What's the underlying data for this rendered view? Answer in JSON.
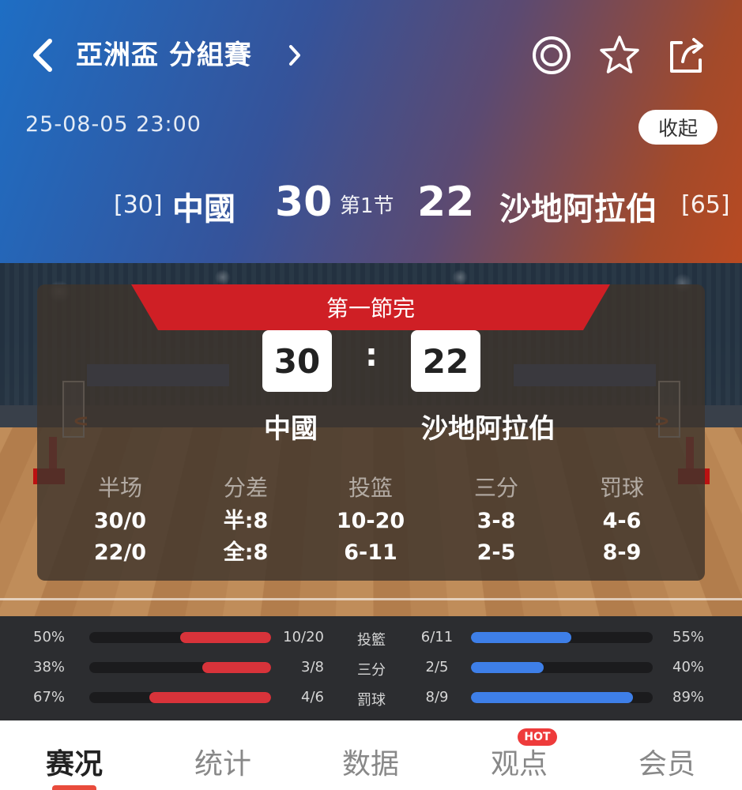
{
  "header": {
    "title": "亞洲盃 分組賽",
    "datetime": "25-08-05 23:00",
    "collapse_label": "收起",
    "home": {
      "rank": "[30]",
      "name": "中國",
      "score": "30"
    },
    "away": {
      "rank": "[65]",
      "name": "沙地阿拉伯",
      "score": "22"
    },
    "period": "第1节",
    "icons": [
      "back-icon",
      "chevron-right-icon",
      "target-icon",
      "star-icon",
      "share-icon"
    ]
  },
  "card": {
    "status": "第一節完",
    "home_score": "30",
    "away_score": "22",
    "colon": ":",
    "home_name": "中國",
    "away_name": "沙地阿拉伯",
    "stats": [
      {
        "label": "半场",
        "v1": "30/0",
        "v2": "22/0"
      },
      {
        "label": "分差",
        "v1": "半:8",
        "v2": "全:8"
      },
      {
        "label": "投篮",
        "v1": "10-20",
        "v2": "6-11"
      },
      {
        "label": "三分",
        "v1": "3-8",
        "v2": "2-5"
      },
      {
        "label": "罚球",
        "v1": "4-6",
        "v2": "8-9"
      }
    ]
  },
  "compare": [
    {
      "pct_l": "50%",
      "val_l": "10/20",
      "label": "投籃",
      "val_r": "6/11",
      "pct_r": "55%",
      "fill_l": 0.5,
      "fill_r": 0.55
    },
    {
      "pct_l": "38%",
      "val_l": "3/8",
      "label": "三分",
      "val_r": "2/5",
      "pct_r": "40%",
      "fill_l": 0.38,
      "fill_r": 0.4
    },
    {
      "pct_l": "67%",
      "val_l": "4/6",
      "label": "罰球",
      "val_r": "8/9",
      "pct_r": "89%",
      "fill_l": 0.67,
      "fill_r": 0.89
    }
  ],
  "colors": {
    "home_bar": "#d8333a",
    "away_bar": "#3e7fe8",
    "accent": "#e94b3c"
  },
  "tabs": [
    {
      "label": "赛况",
      "active": true
    },
    {
      "label": "统计",
      "active": false
    },
    {
      "label": "数据",
      "active": false
    },
    {
      "label": "观点",
      "active": false,
      "badge": "HOT"
    },
    {
      "label": "会员",
      "active": false
    }
  ]
}
